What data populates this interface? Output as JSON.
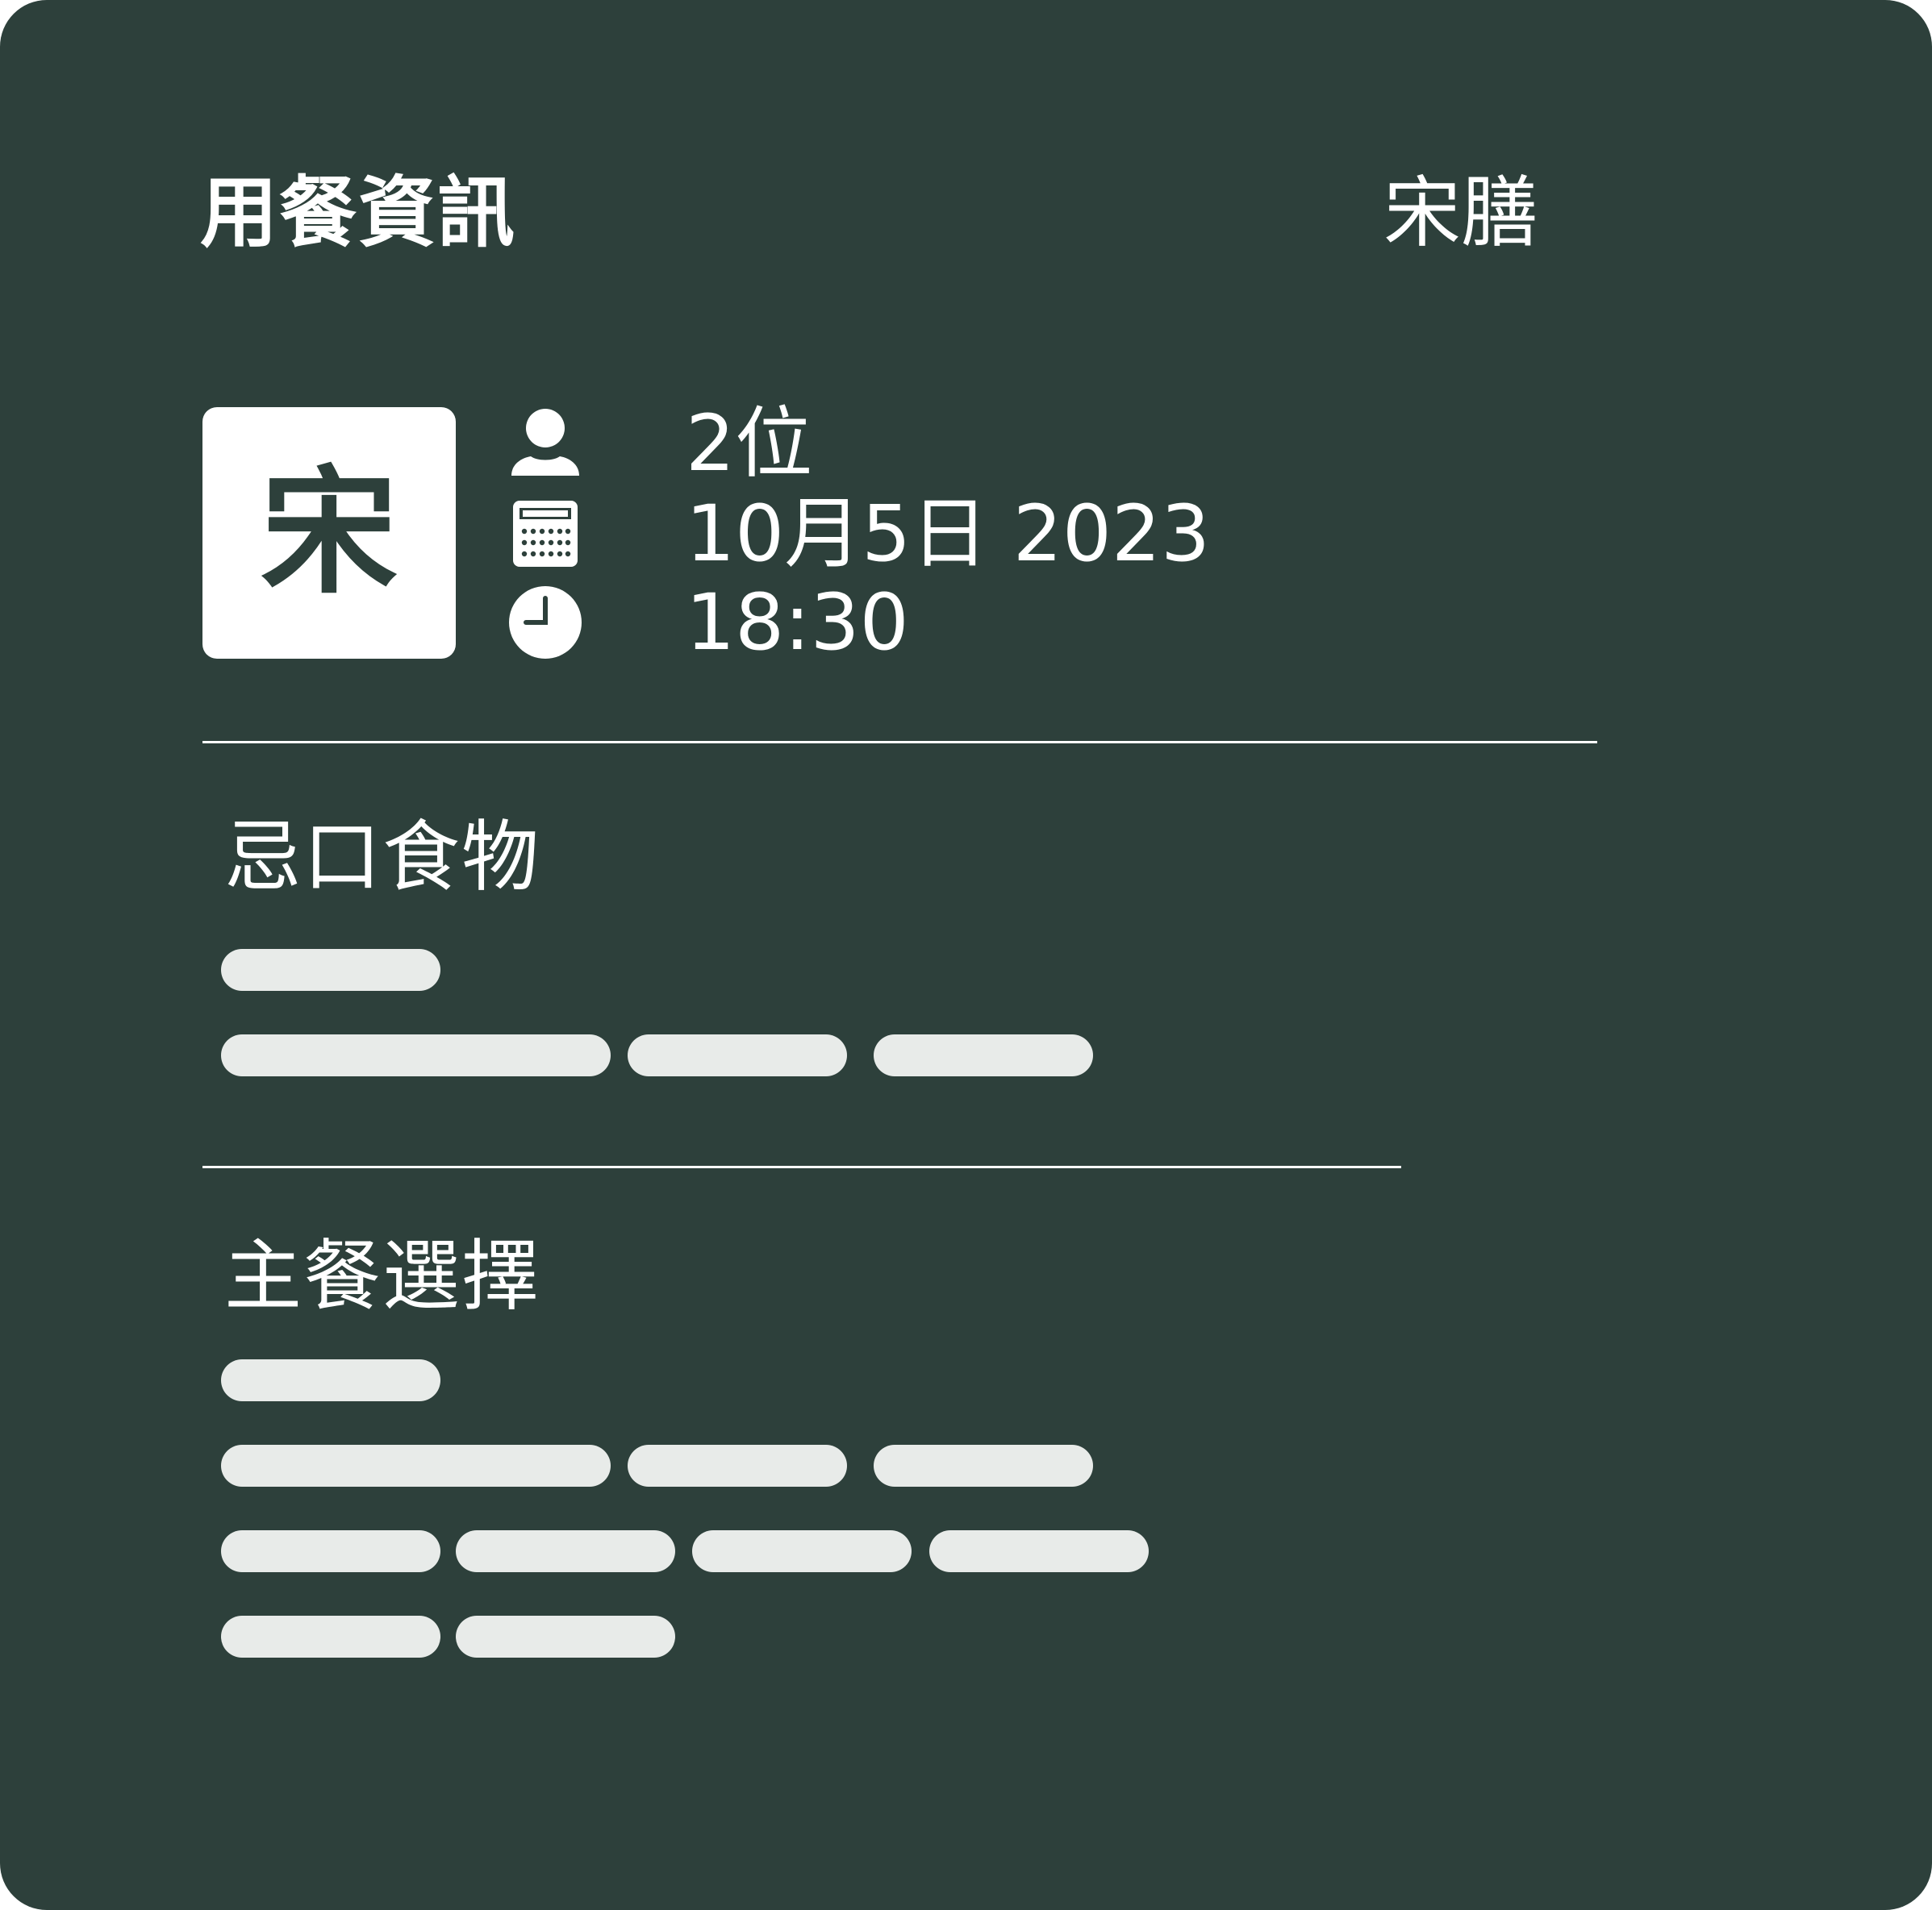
{
  "header": {
    "title": "用餐資訊",
    "brand": "宋膳"
  },
  "logo": {
    "char": "宋"
  },
  "details": {
    "guests": {
      "icon": "person-icon",
      "text": "2位"
    },
    "date": {
      "icon": "calendar-icon",
      "text": "10月5日 2023"
    },
    "time": {
      "icon": "clock-icon",
      "text": "18:30"
    }
  },
  "sections": {
    "dietary": {
      "title": "忌口食物"
    },
    "main_course": {
      "title": "主餐選擇"
    }
  },
  "colors": {
    "background": "#2d403b",
    "text": "#ffffff",
    "placeholder": "#e8ebe9"
  }
}
